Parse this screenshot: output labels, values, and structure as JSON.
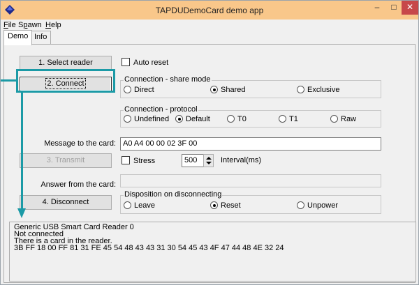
{
  "window": {
    "title": "TAPDUDemoCard demo app",
    "minimize_glyph": "–",
    "maximize_glyph": "□",
    "close_glyph": "✕"
  },
  "menu": {
    "file": {
      "prefix": "",
      "accel": "F",
      "rest": "ile"
    },
    "spawn": {
      "prefix": "S",
      "accel": "p",
      "rest": "awn"
    },
    "help": {
      "prefix": "",
      "accel": "H",
      "rest": "elp"
    }
  },
  "tabs": [
    {
      "label": "Demo"
    },
    {
      "label": "Info"
    }
  ],
  "buttons": {
    "select_reader": "1. Select reader",
    "connect": "2. Connect",
    "transmit": "3. Transmit",
    "disconnect": "4. Disconnect"
  },
  "checkboxes": {
    "auto_reset": {
      "label": "Auto reset",
      "checked": false
    },
    "stress": {
      "label": "Stress",
      "checked": false
    }
  },
  "share_mode": {
    "title": "Connection - share mode",
    "options": [
      {
        "label": "Direct",
        "selected": false
      },
      {
        "label": "Shared",
        "selected": true
      },
      {
        "label": "Exclusive",
        "selected": false
      }
    ]
  },
  "protocol": {
    "title": "Connection - protocol",
    "options": [
      {
        "label": "Undefined",
        "selected": false
      },
      {
        "label": "Default",
        "selected": true
      },
      {
        "label": "T0",
        "selected": false
      },
      {
        "label": "T1",
        "selected": false
      },
      {
        "label": "Raw",
        "selected": false
      }
    ]
  },
  "message": {
    "label": "Message to the card:",
    "value": "A0 A4 00 00 02 3F 00"
  },
  "interval": {
    "value": "500",
    "label": "Interval(ms)"
  },
  "answer": {
    "label": "Answer from the card:",
    "value": ""
  },
  "disposition": {
    "title": "Disposition on disconnecting",
    "options": [
      {
        "label": "Leave",
        "selected": false
      },
      {
        "label": "Reset",
        "selected": true
      },
      {
        "label": "Unpower",
        "selected": false
      }
    ]
  },
  "log": [
    "Generic USB Smart Card Reader 0",
    "Not connected",
    "There is a card in the reader.",
    "3B FF 18 00 FF 81 31 FE 45 54 48 43 43 31 30 54 45 43 4F 47 44 48 4E 32 24"
  ],
  "colors": {
    "titlebar": "#f9c78a",
    "annotation": "#1b9aa6",
    "close_button": "#c7484a"
  }
}
